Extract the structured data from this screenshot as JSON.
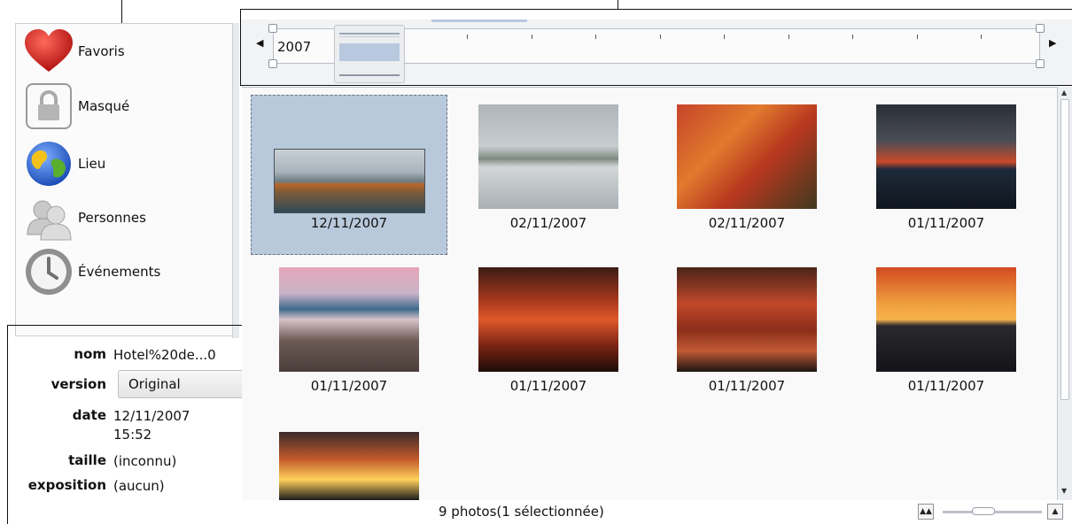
{
  "categories": [
    {
      "label": "Favoris",
      "icon": "heart-icon"
    },
    {
      "label": "Masqué",
      "icon": "lock-icon"
    },
    {
      "label": "Lieu",
      "icon": "globe-icon"
    },
    {
      "label": "Personnes",
      "icon": "people-icon"
    },
    {
      "label": "Événements",
      "icon": "clock-icon"
    }
  ],
  "properties": {
    "name_key": "nom",
    "name_val": "Hotel%20de...0",
    "version_key": "version",
    "version_val": "Original",
    "date_key": "date",
    "date_val1": "12/11/2007",
    "date_val2": "15:52",
    "size_key": "taille",
    "size_val": "(inconnu)",
    "exposure_key": "exposition",
    "exposure_val": "(aucun)"
  },
  "timeline": {
    "year": "2007",
    "prev_icon": "arrow-left-icon",
    "next_icon": "arrow-right-icon"
  },
  "photos": [
    {
      "date": "12/11/2007",
      "selected": true
    },
    {
      "date": "02/11/2007"
    },
    {
      "date": "02/11/2007"
    },
    {
      "date": "01/11/2007"
    },
    {
      "date": "01/11/2007"
    },
    {
      "date": "01/11/2007"
    },
    {
      "date": "01/11/2007"
    },
    {
      "date": "01/11/2007"
    },
    {
      "date": ""
    }
  ],
  "status": {
    "text": "9 photos(1 sélectionnée)"
  },
  "colors": {
    "selection": "#b9c9dc",
    "accent": "#b8c9df"
  }
}
